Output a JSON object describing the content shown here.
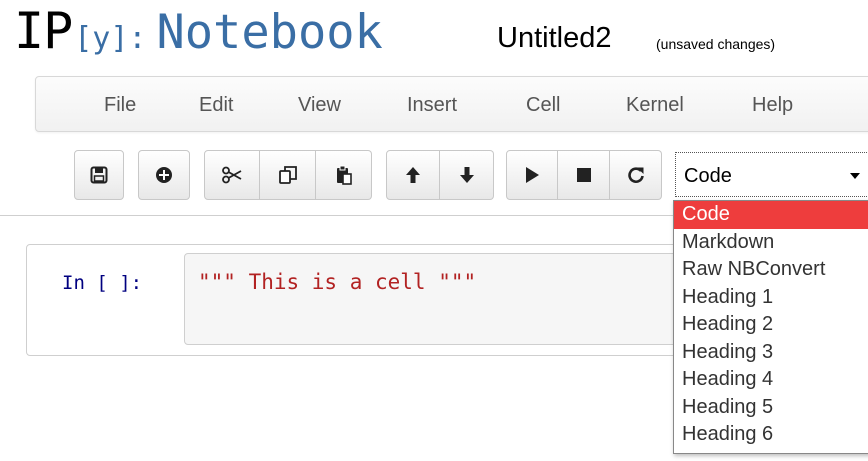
{
  "header": {
    "logo_ip": "IP",
    "logo_y": "[y]:",
    "logo_notebook": "Notebook",
    "notebook_name": "Untitled2",
    "save_status": "(unsaved changes)"
  },
  "menubar": {
    "items": [
      "File",
      "Edit",
      "View",
      "Insert",
      "Cell",
      "Kernel",
      "Help"
    ]
  },
  "toolbar": {
    "icons": [
      "save-icon",
      "plus-circle-icon",
      "cut-icon",
      "copy-icon",
      "paste-icon",
      "arrow-up-icon",
      "arrow-down-icon",
      "play-icon",
      "stop-icon",
      "restart-icon"
    ],
    "cell_type_value": "Code"
  },
  "cell": {
    "prompt": "In [ ]:",
    "code": "\"\"\" This is a cell \"\"\""
  },
  "cell_type_dropdown": {
    "options": [
      "Code",
      "Markdown",
      "Raw NBConvert",
      "Heading 1",
      "Heading 2",
      "Heading 3",
      "Heading 4",
      "Heading 5",
      "Heading 6"
    ],
    "selected_index": 0,
    "highlight_color": "#ee3d3d"
  },
  "colors": {
    "logo_blue": "#3a6ea5",
    "prompt_blue": "#000080",
    "code_red": "#b22222"
  }
}
